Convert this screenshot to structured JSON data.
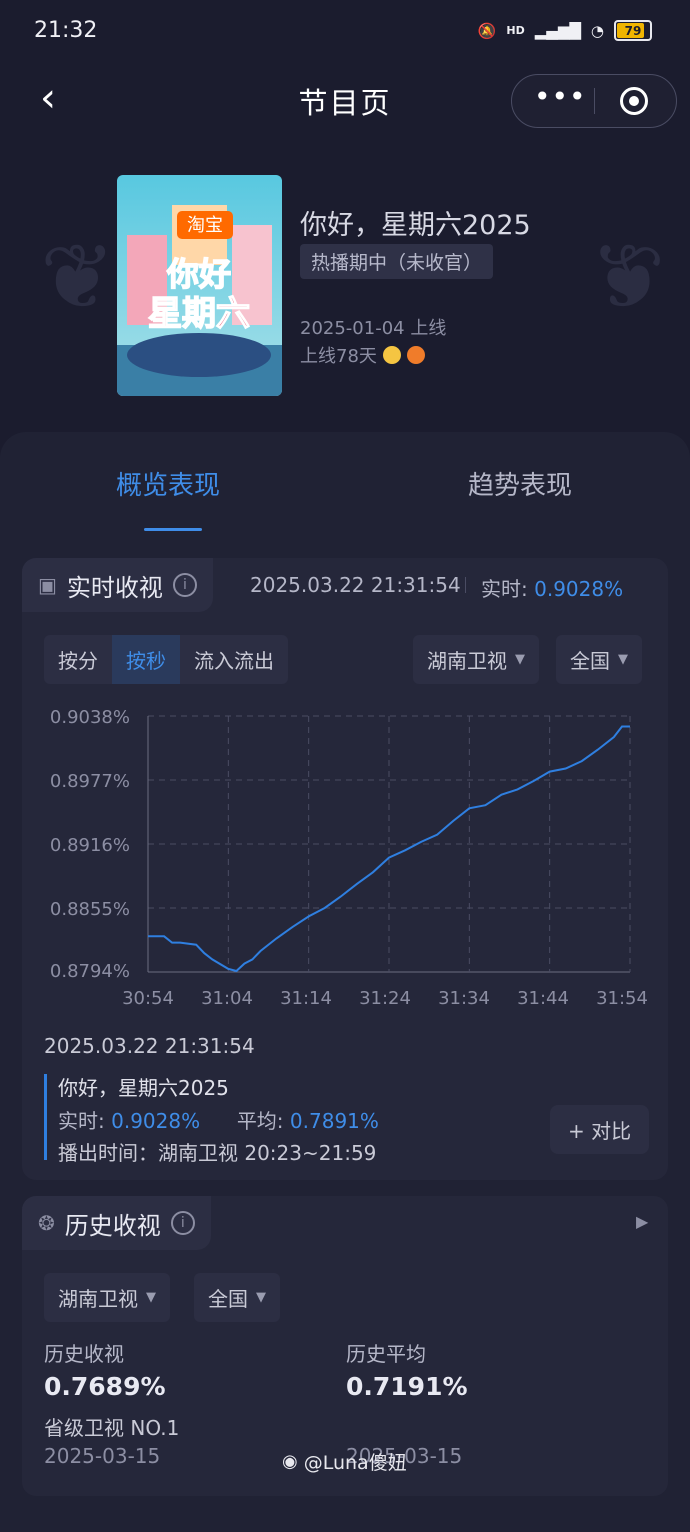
{
  "status_bar": {
    "time": "21:32",
    "network": "HD",
    "battery": "79"
  },
  "nav": {
    "title": "节目页",
    "more_icon": "more-dots-icon",
    "close_icon": "target-icon"
  },
  "show": {
    "title": "你好，星期六2025",
    "status_tag": "热播期中（未收官）",
    "premiere": "2025-01-04 上线",
    "days_online": "上线78天",
    "poster_brand": "淘宝",
    "poster_title_1": "你好",
    "poster_title_2": "星期六"
  },
  "tabs": [
    {
      "label": "概览表现",
      "active": true
    },
    {
      "label": "趋势表现",
      "active": false
    }
  ],
  "realtime": {
    "title": "实时收视",
    "timestamp": "2025.03.22 21:31:54",
    "rt_label": "实时:",
    "rt_value": "0.9028%",
    "modes": [
      "按分",
      "按秒",
      "流入流出"
    ],
    "active_mode": 1,
    "channel": "湖南卫视",
    "region": "全国",
    "detail_timestamp": "2025.03.22 21:31:54",
    "detail_show": "你好，星期六2025",
    "detail_rt_label": "实时:",
    "detail_rt_value": "0.9028%",
    "detail_avg_label": "平均:",
    "detail_avg_value": "0.7891%",
    "detail_airtime": "播出时间：湖南卫视 20:23~21:59",
    "compare_button": "+ 对比"
  },
  "chart_data": {
    "type": "line",
    "title": "",
    "xlabel": "",
    "ylabel": "",
    "y_ticks": [
      "0.9038%",
      "0.8977%",
      "0.8916%",
      "0.8855%",
      "0.8794%"
    ],
    "x_ticks": [
      "30:54",
      "31:04",
      "31:14",
      "31:24",
      "31:34",
      "31:44",
      "31:54"
    ],
    "ylim": [
      0.8794,
      0.9038
    ],
    "xlim": [
      0,
      60
    ],
    "grid": true,
    "series": [
      {
        "color": "#2f7fe0",
        "x": [
          0,
          2,
          3,
          4,
          6,
          7,
          8,
          10,
          11,
          12,
          13,
          14,
          16,
          18,
          20,
          22,
          24,
          26,
          28,
          30,
          32,
          34,
          36,
          38,
          40,
          42,
          44,
          46,
          48,
          50,
          52,
          54,
          56,
          58,
          59,
          60
        ],
        "y": [
          0.8828,
          0.8828,
          0.8822,
          0.8822,
          0.882,
          0.8812,
          0.8806,
          0.8797,
          0.8795,
          0.8802,
          0.8806,
          0.8814,
          0.8826,
          0.8837,
          0.8847,
          0.8855,
          0.8866,
          0.8878,
          0.8889,
          0.8903,
          0.891,
          0.8918,
          0.8925,
          0.8938,
          0.895,
          0.8953,
          0.8963,
          0.8968,
          0.8976,
          0.8985,
          0.8988,
          0.8995,
          0.9006,
          0.9018,
          0.9028,
          0.9028
        ]
      }
    ]
  },
  "history": {
    "title": "历史收视",
    "channel": "湖南卫视",
    "region": "全国",
    "hist_label": "历史收视",
    "hist_value": "0.7689%",
    "hist_rank": "省级卫视 NO.1",
    "hist_date": "2025-03-15",
    "avg_label": "历史平均",
    "avg_value": "0.7191%",
    "avg_date": "2025-03-15"
  },
  "watermark": "@Luna傻妞"
}
